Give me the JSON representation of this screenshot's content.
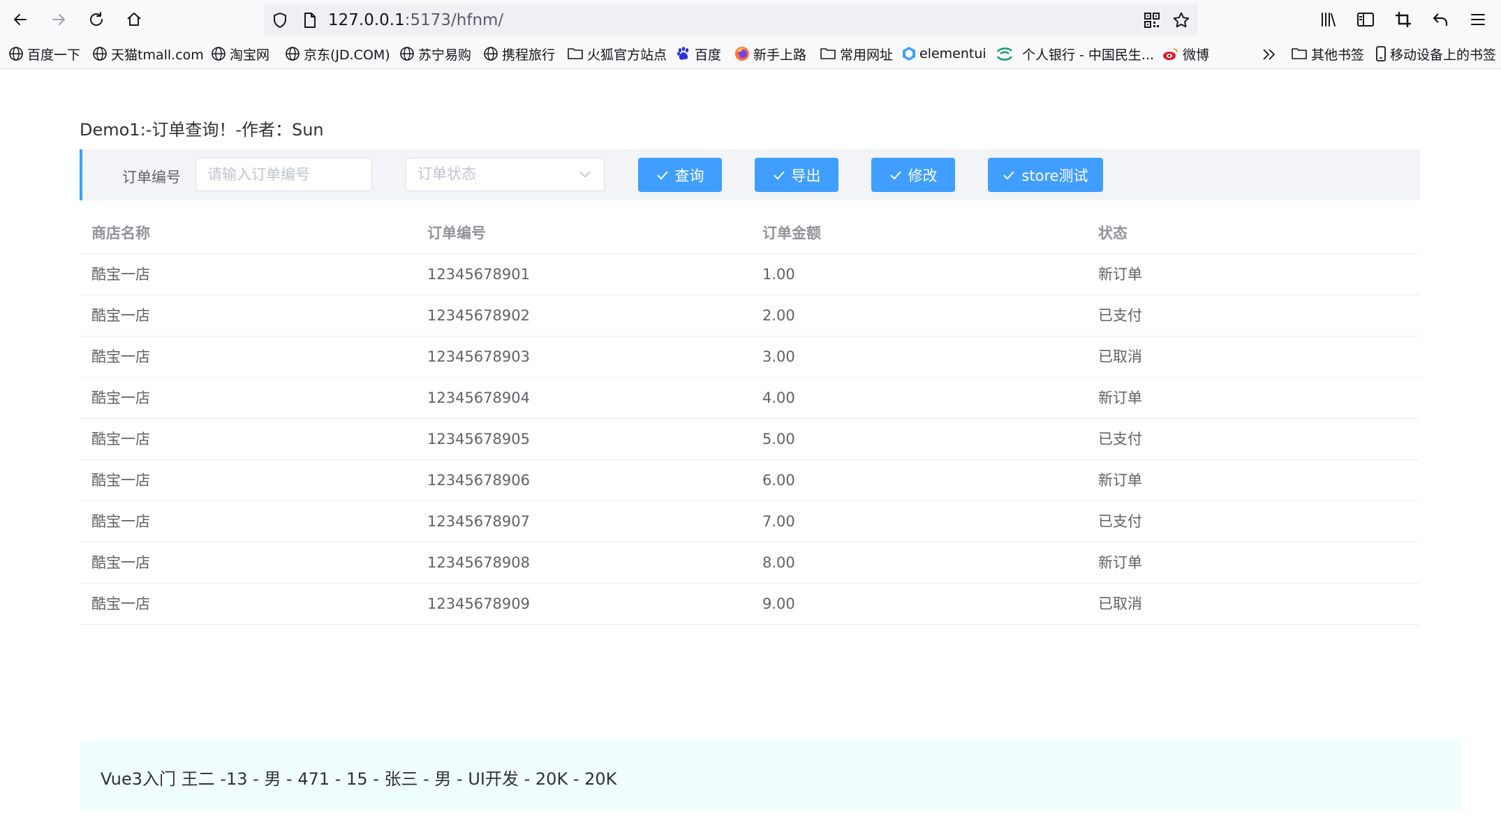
{
  "browser": {
    "url_host": "127.0.0.1",
    "url_rest": ":5173/hfnm/",
    "bookmarks": [
      {
        "label": "百度一下",
        "icon": "globe-icon"
      },
      {
        "label": "天猫tmall.com",
        "icon": "globe-icon"
      },
      {
        "label": "淘宝网",
        "icon": "globe-icon"
      },
      {
        "label": "京东(JD.COM)",
        "icon": "globe-icon"
      },
      {
        "label": "苏宁易购",
        "icon": "globe-icon"
      },
      {
        "label": "携程旅行",
        "icon": "globe-icon"
      },
      {
        "label": "火狐官方站点",
        "icon": "folder-icon"
      },
      {
        "label": "百度",
        "icon": "baidu-paw-icon"
      },
      {
        "label": "新手上路",
        "icon": "firefox-icon"
      },
      {
        "label": "常用网址",
        "icon": "folder-icon"
      },
      {
        "label": "elementui",
        "icon": "element-hex-icon"
      },
      {
        "label": "个人银行 - 中国民生...",
        "icon": "minsheng-bank-icon"
      },
      {
        "label": "微博",
        "icon": "weibo-icon"
      }
    ],
    "other_bookmarks": "其他书签",
    "mobile_bookmarks": "移动设备上的书签"
  },
  "page": {
    "title": "Demo1:-订单查询！-作者：Sun"
  },
  "form": {
    "order_no_label": "订单编号",
    "order_no_placeholder": "请输入订单编号",
    "order_no_value": "",
    "status_placeholder": "订单状态",
    "buttons": {
      "query": "查询",
      "export": "导出",
      "edit": "修改",
      "store_test": "store测试"
    }
  },
  "table": {
    "columns": [
      "商店名称",
      "订单编号",
      "订单金额",
      "状态"
    ],
    "rows": [
      [
        "酷宝一店",
        "12345678901",
        "1.00",
        "新订单"
      ],
      [
        "酷宝一店",
        "12345678902",
        "2.00",
        "已支付"
      ],
      [
        "酷宝一店",
        "12345678903",
        "3.00",
        "已取消"
      ],
      [
        "酷宝一店",
        "12345678904",
        "4.00",
        "新订单"
      ],
      [
        "酷宝一店",
        "12345678905",
        "5.00",
        "已支付"
      ],
      [
        "酷宝一店",
        "12345678906",
        "6.00",
        "新订单"
      ],
      [
        "酷宝一店",
        "12345678907",
        "7.00",
        "已支付"
      ],
      [
        "酷宝一店",
        "12345678908",
        "8.00",
        "新订单"
      ],
      [
        "酷宝一店",
        "12345678909",
        "9.00",
        "已取消"
      ]
    ]
  },
  "footer": {
    "text": "Vue3入门 王二 -13 - 男 - 471 - 15 - 张三 - 男 - UI开发 - 20K - 20K"
  },
  "colors": {
    "primary": "#409eff",
    "footer_bg": "#f0feff",
    "form_bg": "#f2f4f7"
  }
}
